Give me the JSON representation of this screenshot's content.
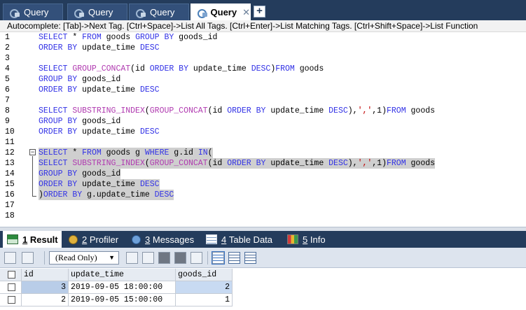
{
  "query_tabs": [
    {
      "label": "Query",
      "active": false,
      "closable": false
    },
    {
      "label": "Query",
      "active": false,
      "closable": false
    },
    {
      "label": "Query",
      "active": false,
      "closable": false
    },
    {
      "label": "Query",
      "active": true,
      "closable": true
    }
  ],
  "close_glyph": "✕",
  "new_tab_glyph": "+",
  "autocomplete_hint": "Autocomplete: [Tab]->Next Tag. [Ctrl+Space]->List All Tags. [Ctrl+Enter]->List Matching Tags. [Ctrl+Shift+Space]->List Function",
  "editor": {
    "line_numbers": [
      "1",
      "2",
      "3",
      "4",
      "5",
      "6",
      "7",
      "8",
      "9",
      "10",
      "11",
      "12",
      "13",
      "14",
      "15",
      "16",
      "17",
      "18",
      "18"
    ],
    "lines": [
      [
        [
          "kw",
          "SELECT"
        ],
        [
          "t",
          " * "
        ],
        [
          "kw",
          "FROM"
        ],
        [
          "t",
          " goods "
        ],
        [
          "kw",
          "GROUP BY"
        ],
        [
          "t",
          " goods_id"
        ]
      ],
      [
        [
          "kw",
          "ORDER BY"
        ],
        [
          "t",
          " update_time "
        ],
        [
          "kw",
          "DESC"
        ]
      ],
      [],
      [
        [
          "kw",
          "SELECT"
        ],
        [
          "t",
          " "
        ],
        [
          "fn",
          "GROUP_CONCAT"
        ],
        [
          "t",
          "(id "
        ],
        [
          "kw",
          "ORDER BY"
        ],
        [
          "t",
          " update_time "
        ],
        [
          "kw",
          "DESC"
        ],
        [
          "t",
          ")"
        ],
        [
          "kw",
          "FROM"
        ],
        [
          "t",
          " goods"
        ]
      ],
      [
        [
          "kw",
          "GROUP BY"
        ],
        [
          "t",
          " goods_id"
        ]
      ],
      [
        [
          "kw",
          "ORDER BY"
        ],
        [
          "t",
          " update_time "
        ],
        [
          "kw",
          "DESC"
        ]
      ],
      [],
      [
        [
          "kw",
          "SELECT"
        ],
        [
          "t",
          " "
        ],
        [
          "fn",
          "SUBSTRING_INDEX"
        ],
        [
          "t",
          "("
        ],
        [
          "fn",
          "GROUP_CONCAT"
        ],
        [
          "t",
          "(id "
        ],
        [
          "kw",
          "ORDER BY"
        ],
        [
          "t",
          " update_time "
        ],
        [
          "kw",
          "DESC"
        ],
        [
          "t",
          "),"
        ],
        [
          "str",
          "','"
        ],
        [
          "t",
          ",1)"
        ],
        [
          "kw",
          "FROM"
        ],
        [
          "t",
          " goods"
        ]
      ],
      [
        [
          "kw",
          "GROUP BY"
        ],
        [
          "t",
          " goods_id"
        ]
      ],
      [
        [
          "kw",
          "ORDER BY"
        ],
        [
          "t",
          " update_time "
        ],
        [
          "kw",
          "DESC"
        ]
      ],
      [],
      [
        [
          "kw",
          "SELECT"
        ],
        [
          "t",
          " * "
        ],
        [
          "kw",
          "FROM"
        ],
        [
          "t",
          " goods g "
        ],
        [
          "kw",
          "WHERE"
        ],
        [
          "t",
          " g.id "
        ],
        [
          "kw",
          "IN"
        ],
        [
          "t",
          "("
        ]
      ],
      [
        [
          "kw",
          "SELECT"
        ],
        [
          "t",
          " "
        ],
        [
          "fn",
          "SUBSTRING_INDEX"
        ],
        [
          "t",
          "("
        ],
        [
          "fn",
          "GROUP_CONCAT"
        ],
        [
          "t",
          "(id "
        ],
        [
          "kw",
          "ORDER BY"
        ],
        [
          "t",
          " update_time "
        ],
        [
          "kw",
          "DESC"
        ],
        [
          "t",
          "),"
        ],
        [
          "str",
          "','"
        ],
        [
          "t",
          ",1)"
        ],
        [
          "kw",
          "FROM"
        ],
        [
          "t",
          " goods"
        ]
      ],
      [
        [
          "kw",
          "GROUP BY"
        ],
        [
          "t",
          " goods_id"
        ]
      ],
      [
        [
          "kw",
          "ORDER BY"
        ],
        [
          "t",
          " update_time "
        ],
        [
          "kw",
          "DESC"
        ]
      ],
      [
        [
          "t",
          ")"
        ],
        [
          "kw",
          "ORDER BY"
        ],
        [
          "t",
          " g.update_time "
        ],
        [
          "kw",
          "DESC"
        ]
      ],
      [],
      []
    ],
    "selected_lines": [
      11,
      12,
      13,
      14,
      15
    ]
  },
  "result_tabs": [
    {
      "num": "1",
      "label": "Result",
      "icon": "result-grid-icon",
      "active": true
    },
    {
      "num": "2",
      "label": "Profiler",
      "icon": "profiler-icon",
      "active": false
    },
    {
      "num": "3",
      "label": "Messages",
      "icon": "messages-icon",
      "active": false
    },
    {
      "num": "4",
      "label": "Table Data",
      "icon": "table-data-icon",
      "active": false
    },
    {
      "num": "5",
      "label": "Info",
      "icon": "info-icon",
      "active": false
    }
  ],
  "result_mode": "(Read Only)",
  "result_mode_arrow": "▼",
  "grid": {
    "columns": [
      "id",
      "update_time",
      "goods_id"
    ],
    "rows": [
      [
        "3",
        "2019-09-05 18:00:00",
        "2"
      ],
      [
        "2",
        "2019-09-05 15:00:00",
        "1"
      ]
    ]
  }
}
